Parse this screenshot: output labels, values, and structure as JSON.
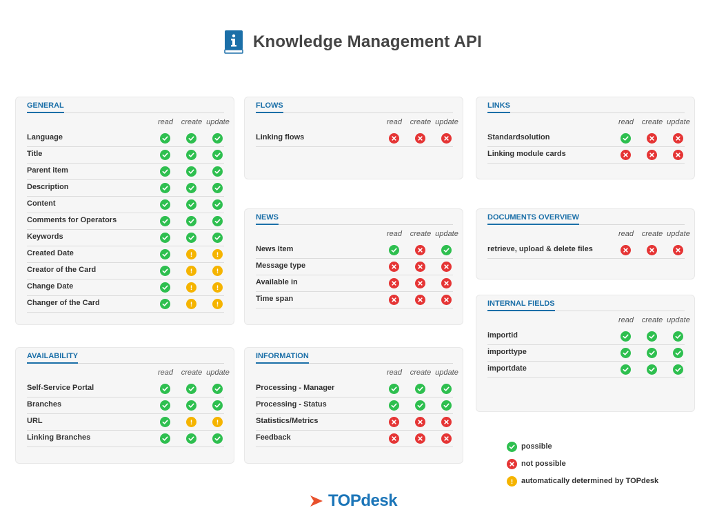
{
  "page": {
    "title": "Knowledge Management API",
    "title_icon": "info-book-icon"
  },
  "columns": [
    "read",
    "create",
    "update"
  ],
  "colors": {
    "accent": "#1b6fa8",
    "possible": "#2ebf4f",
    "not_possible": "#e53535",
    "auto": "#f5b400"
  },
  "cards": [
    {
      "id": "general",
      "title": "GENERAL",
      "rows": [
        {
          "label": "Language",
          "s": [
            "yes",
            "yes",
            "yes"
          ]
        },
        {
          "label": "Title",
          "s": [
            "yes",
            "yes",
            "yes"
          ]
        },
        {
          "label": "Parent item",
          "s": [
            "yes",
            "yes",
            "yes"
          ]
        },
        {
          "label": "Description",
          "s": [
            "yes",
            "yes",
            "yes"
          ]
        },
        {
          "label": "Content",
          "s": [
            "yes",
            "yes",
            "yes"
          ]
        },
        {
          "label": "Comments for Operators",
          "s": [
            "yes",
            "yes",
            "yes"
          ]
        },
        {
          "label": "Keywords",
          "s": [
            "yes",
            "yes",
            "yes"
          ]
        },
        {
          "label": "Created Date",
          "s": [
            "yes",
            "auto",
            "auto"
          ]
        },
        {
          "label": "Creator of the Card",
          "s": [
            "yes",
            "auto",
            "auto"
          ]
        },
        {
          "label": "Change Date",
          "s": [
            "yes",
            "auto",
            "auto"
          ]
        },
        {
          "label": "Changer of the Card",
          "s": [
            "yes",
            "auto",
            "auto"
          ]
        }
      ]
    },
    {
      "id": "flows",
      "title": "FLOWS",
      "rows": [
        {
          "label": "Linking flows",
          "s": [
            "no",
            "no",
            "no"
          ]
        }
      ]
    },
    {
      "id": "links",
      "title": "LINKS",
      "rows": [
        {
          "label": "Standardsolution",
          "s": [
            "yes",
            "no",
            "no"
          ]
        },
        {
          "label": "Linking module cards",
          "s": [
            "no",
            "no",
            "no"
          ]
        }
      ]
    },
    {
      "id": "news",
      "title": "NEWS",
      "rows": [
        {
          "label": "News Item",
          "s": [
            "yes",
            "no",
            "yes"
          ]
        },
        {
          "label": "Message type",
          "s": [
            "no",
            "no",
            "no"
          ]
        },
        {
          "label": "Available in",
          "s": [
            "no",
            "no",
            "no"
          ]
        },
        {
          "label": "Time span",
          "s": [
            "no",
            "no",
            "no"
          ]
        }
      ]
    },
    {
      "id": "documents",
      "title": "DOCUMENTS OVERVIEW",
      "rows": [
        {
          "label": "retrieve, upload & delete files",
          "s": [
            "no",
            "no",
            "no"
          ]
        }
      ]
    },
    {
      "id": "internal",
      "title": "INTERNAL FIELDS",
      "rows": [
        {
          "label": "importid",
          "s": [
            "yes",
            "yes",
            "yes"
          ]
        },
        {
          "label": "importtype",
          "s": [
            "yes",
            "yes",
            "yes"
          ]
        },
        {
          "label": "importdate",
          "s": [
            "yes",
            "yes",
            "yes"
          ]
        }
      ]
    },
    {
      "id": "availability",
      "title": "AVAILABILITY",
      "rows": [
        {
          "label": "Self-Service Portal",
          "s": [
            "yes",
            "yes",
            "yes"
          ]
        },
        {
          "label": "Branches",
          "s": [
            "yes",
            "yes",
            "yes"
          ]
        },
        {
          "label": "URL",
          "s": [
            "yes",
            "auto",
            "auto"
          ]
        },
        {
          "label": "Linking Branches",
          "s": [
            "yes",
            "yes",
            "yes"
          ]
        }
      ]
    },
    {
      "id": "information",
      "title": "INFORMATION",
      "rows": [
        {
          "label": "Processing - Manager",
          "s": [
            "yes",
            "yes",
            "yes"
          ]
        },
        {
          "label": "Processing - Status",
          "s": [
            "yes",
            "yes",
            "yes"
          ]
        },
        {
          "label": "Statistics/Metrics",
          "s": [
            "no",
            "no",
            "no"
          ]
        },
        {
          "label": "Feedback",
          "s": [
            "no",
            "no",
            "no"
          ]
        }
      ]
    }
  ],
  "legend": [
    {
      "status": "yes",
      "label": "possible"
    },
    {
      "status": "no",
      "label": "not possible"
    },
    {
      "status": "auto",
      "label": "automatically determined by TOPdesk"
    }
  ],
  "logo": {
    "text": "TOPdesk",
    "icon": "topdesk-logo-icon"
  }
}
